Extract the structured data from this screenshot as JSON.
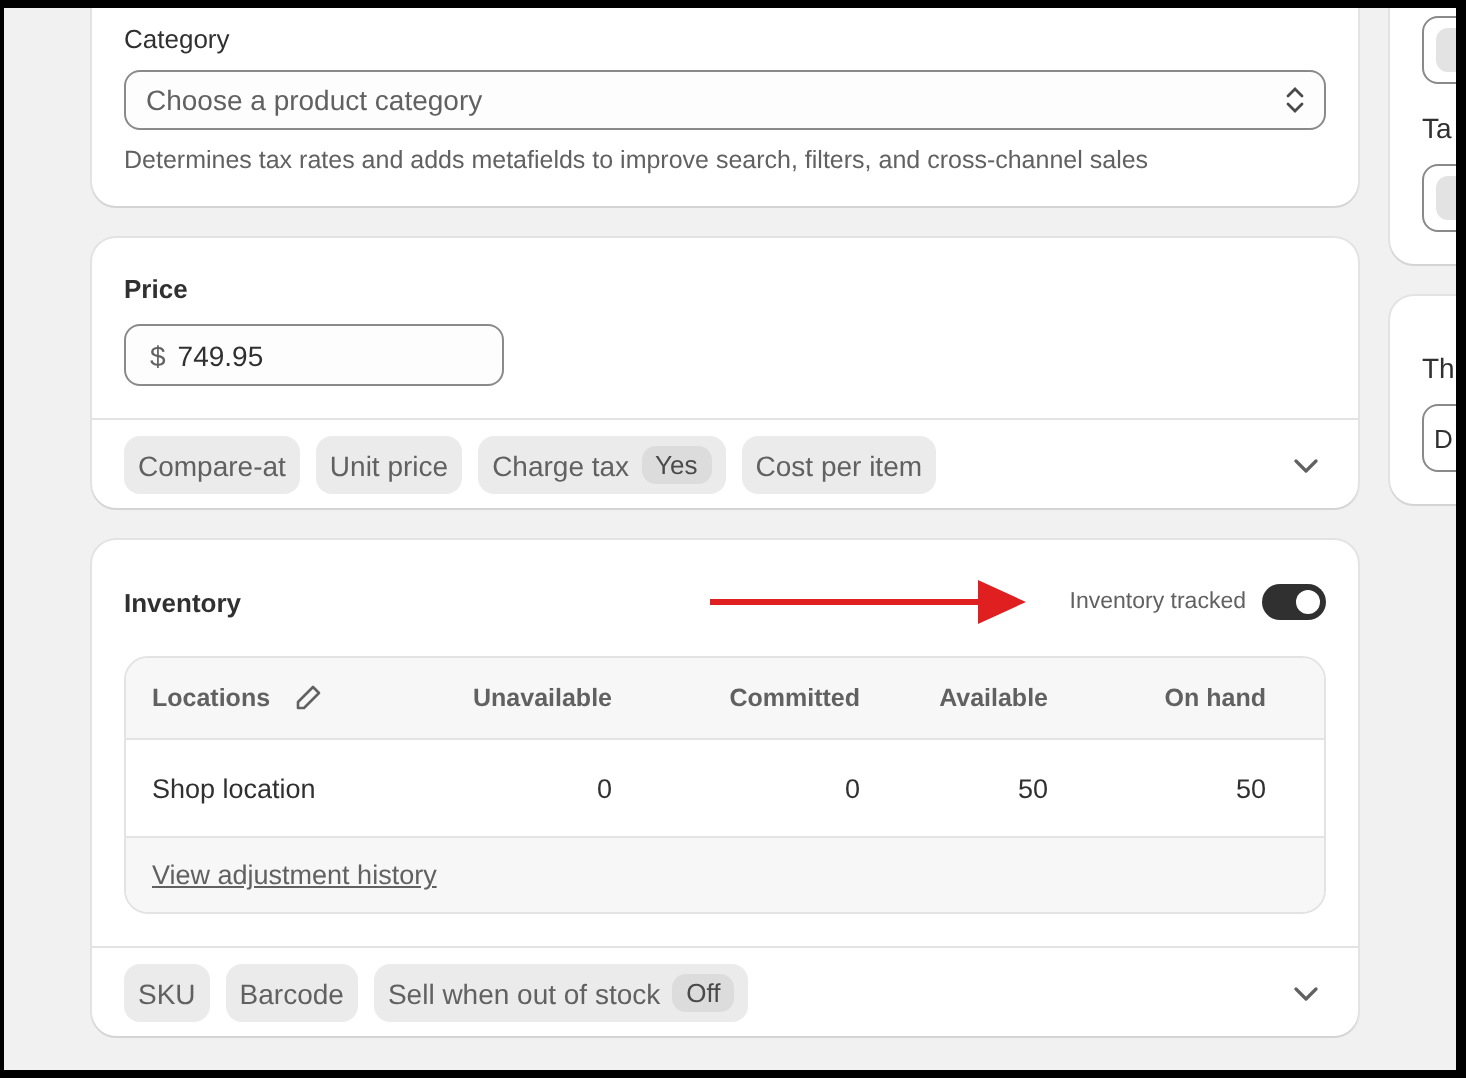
{
  "category": {
    "label": "Category",
    "placeholder": "Choose a product category",
    "help": "Determines tax rates and adds metafields to improve search, filters, and cross-channel sales"
  },
  "price": {
    "title": "Price",
    "currency": "$",
    "value": "749.95",
    "options": [
      {
        "label": "Compare-at"
      },
      {
        "label": "Unit price"
      },
      {
        "label": "Charge tax",
        "badge": "Yes"
      },
      {
        "label": "Cost per item"
      }
    ]
  },
  "inventory": {
    "title": "Inventory",
    "tracked_label": "Inventory tracked",
    "tracked_on": true,
    "table": {
      "columns": [
        "Locations",
        "Unavailable",
        "Committed",
        "Available",
        "On hand"
      ],
      "rows": [
        [
          "Shop location",
          "0",
          "0",
          "50",
          "50"
        ]
      ]
    },
    "history_link": "View adjustment history",
    "options": [
      {
        "label": "SKU"
      },
      {
        "label": "Barcode"
      },
      {
        "label": "Sell when out of stock",
        "badge": "Off"
      }
    ]
  },
  "side_cards": [
    {
      "fields": [
        {
          "kind": "tags"
        },
        {
          "kind": "tags",
          "label": "Ta"
        }
      ]
    },
    {
      "fields": [
        {
          "kind": "text",
          "label": "Th",
          "value": "D"
        }
      ]
    }
  ]
}
